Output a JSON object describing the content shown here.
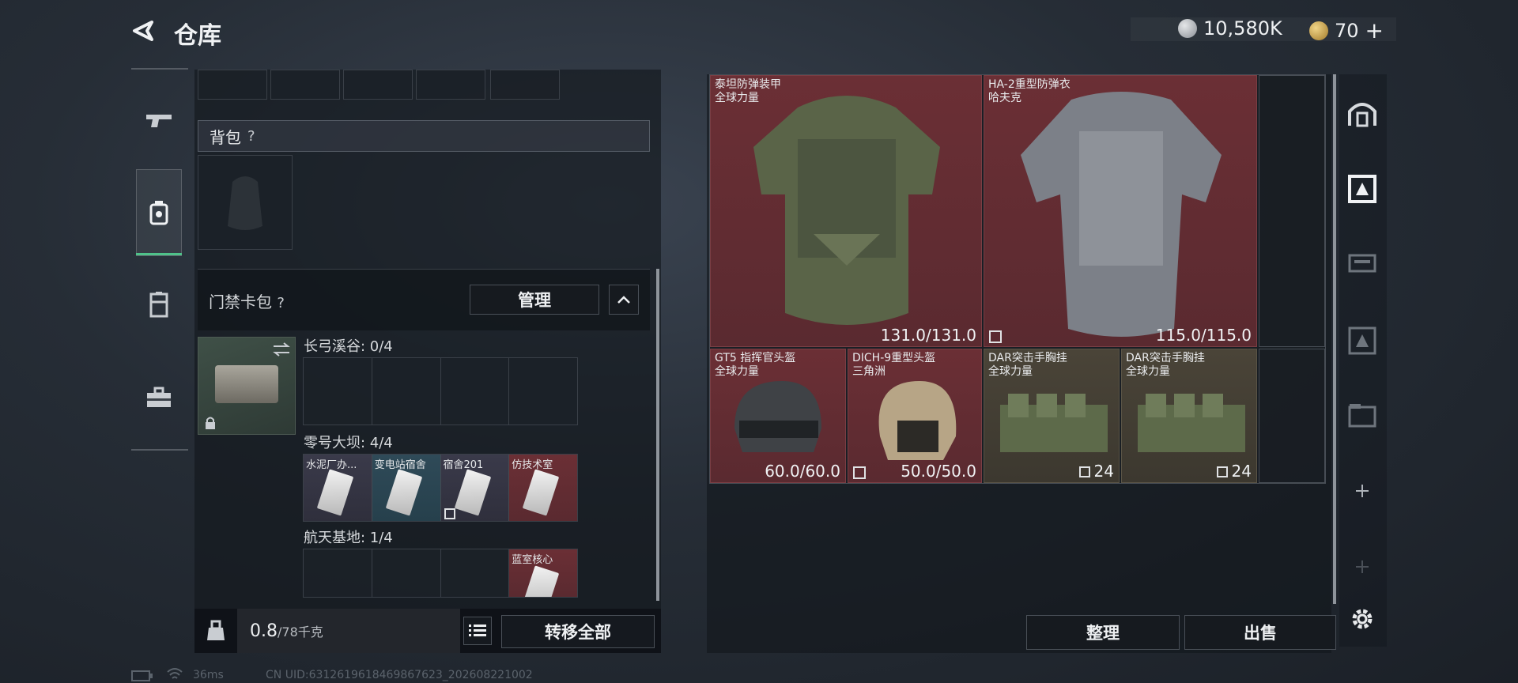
{
  "header": {
    "title": "仓库",
    "currency1": "10,580K",
    "currency2": "70",
    "plus": "+"
  },
  "left_nav": {
    "tabs": [
      "weapon-tab",
      "equipment-tab",
      "locker-tab",
      "case-tab"
    ]
  },
  "backpack": {
    "label": "背包",
    "help": "?"
  },
  "keycard": {
    "label": "门禁卡包",
    "help": "?",
    "manage": "管理",
    "sections": [
      {
        "title": "长弓溪谷: 0/4",
        "cards": []
      },
      {
        "title": "零号大坝: 4/4",
        "cards": [
          "水泥厂办...",
          "变电站宿舍",
          "宿舍201",
          "仿技术室"
        ]
      },
      {
        "title": "航天基地: 1/4",
        "cards": [
          "蓝室核心"
        ]
      }
    ]
  },
  "bottom_left": {
    "weight": "0.8",
    "weight_max": "/78千克",
    "transfer_all": "转移全部"
  },
  "items": [
    {
      "name": "泰坦防弹装甲",
      "sub": "全球力量",
      "value": "131.0/131.0"
    },
    {
      "name": "HA-2重型防弹衣",
      "sub": "哈夫克",
      "value": "115.0/115.0"
    },
    {
      "name": "GT5 指挥官头盔",
      "sub": "全球力量",
      "value": "60.0/60.0"
    },
    {
      "name": "DICH-9重型头盔",
      "sub": "三角洲",
      "value": "50.0/50.0"
    },
    {
      "name": "DAR突击手胸挂",
      "sub": "全球力量",
      "value": "24"
    },
    {
      "name": "DAR突击手胸挂",
      "sub": "全球力量",
      "value": "24"
    }
  ],
  "actions": {
    "sort": "整理",
    "sell": "出售"
  },
  "status": {
    "ping": "36ms",
    "uid": "CN UID:6312619618469867623_202608221002"
  },
  "colors": {
    "rare_red": "#6b2f35",
    "olive": "#4a4438",
    "accent_green": "#4fc28a"
  }
}
